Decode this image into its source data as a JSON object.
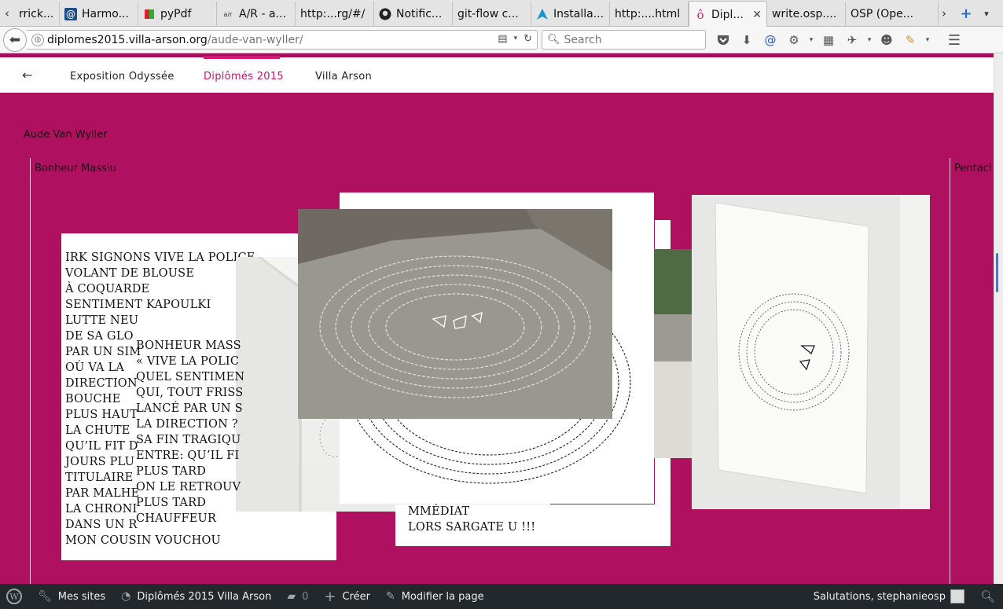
{
  "browser": {
    "tabs": [
      {
        "label": "rrick...",
        "favicon": "page-icon"
      },
      {
        "label": "Harmo...",
        "favicon": "at-icon"
      },
      {
        "label": "pyPdf",
        "favicon": "pypdf-icon"
      },
      {
        "label": "A/R - a...",
        "favicon": "ar-icon"
      },
      {
        "label": "http:...rg/#/",
        "favicon": "page-icon"
      },
      {
        "label": "Notific...",
        "favicon": "github-icon"
      },
      {
        "label": "git-flow c...",
        "favicon": "page-icon"
      },
      {
        "label": "Installa...",
        "favicon": "arch-icon"
      },
      {
        "label": "http:....html",
        "favicon": "page-icon"
      },
      {
        "label": "Dipl...",
        "favicon": "villa-arson-icon",
        "active": true
      },
      {
        "label": "write.osp....",
        "favicon": "page-icon"
      },
      {
        "label": "OSP (Ope...",
        "favicon": "page-icon"
      }
    ],
    "url_domain": "diplomes2015.villa-arson.org",
    "url_path": "/aude-van-wyller/",
    "search_placeholder": "Search"
  },
  "site_nav": {
    "back_arrow": "←",
    "items": [
      "Exposition Odyssée",
      "Diplômés 2015",
      "Villa Arson"
    ],
    "active_index": 1
  },
  "artist": {
    "name": "Aude Van Wyller"
  },
  "works": {
    "left_title": "Bonheur Massiu",
    "right_title": "Pentacl"
  },
  "poems": {
    "card_1": "IRK SIGNONS VIVE LA POLICE\nVOLANT DE BLOUSE\nÀ COQUARDE\nSENTIMENT KAPOULKI\nLUTTE NEU\nDE SA GLO\nPAR UN SIM\nOÙ VA LA\nDIRECTION\nBOUCHE\nPLUS HAUT\nLA CHUTE\nQU’IL FIT D\nJOURS PLU\nTITULAIRE\nPAR MALHE\nLA CHRONI\nDANS UN R\nMON COUSIN VOUCHOU",
    "card_2": "BONHEUR MASS\n« VIVE LA POLIC\nQUEL SENTIMEN\nQUI, TOUT FRISS\nLANCÉ PAR UN S\nLA DIRECTION ?\nSA FIN TRAGIQU\nENTRE: QU’IL FI\nPLUS TARD\nON LE RETROUV\nPLUS TARD\nCHAUFFEUR",
    "card_3": "MMÉDIAT\nLORS SARGATE U !!!"
  },
  "adminbar": {
    "wp_logo": "wordpress-icon",
    "my_sites": "Mes sites",
    "site_name": "Diplômés 2015 Villa Arson",
    "comments_count": "0",
    "create": "Créer",
    "edit_page": "Modifier la page",
    "greeting": "Salutations, stephanieosp"
  },
  "colors": {
    "page_bg": "#b01060",
    "accent": "#d11a6f",
    "adminbar_bg": "#23282d"
  }
}
